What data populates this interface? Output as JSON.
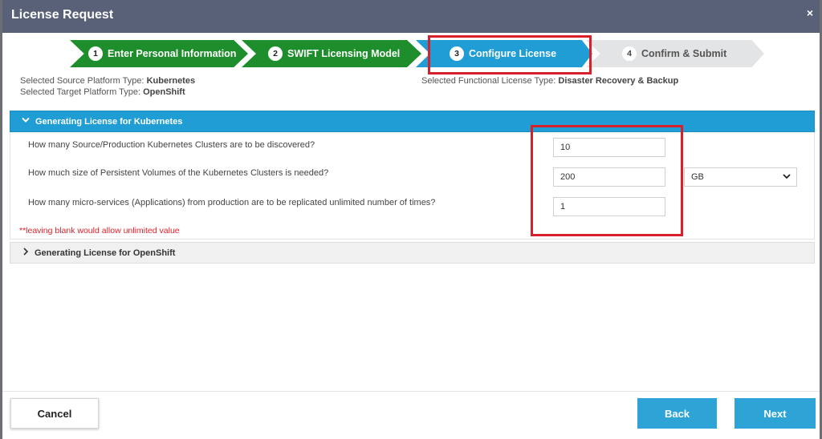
{
  "dialog": {
    "title": "License Request",
    "close_glyph": "×"
  },
  "stepper": {
    "steps": [
      {
        "num": "1",
        "label": "Enter Personal Information",
        "state": "done"
      },
      {
        "num": "2",
        "label": "SWIFT Licensing Model",
        "state": "done"
      },
      {
        "num": "3",
        "label": "Configure License",
        "state": "active"
      },
      {
        "num": "4",
        "label": "Confirm & Submit",
        "state": "pending"
      }
    ]
  },
  "info": {
    "source_label": "Selected Source Platform Type:",
    "source_value": "Kubernetes",
    "target_label": "Selected Target Platform Type:",
    "target_value": "OpenShift",
    "functional_label": "Selected Functional License Type:",
    "functional_value": "Disaster Recovery & Backup"
  },
  "panels": {
    "kubernetes": {
      "title": "Generating License for Kubernetes",
      "questions": [
        {
          "label": "How many Source/Production Kubernetes Clusters are to be discovered?",
          "value": "10"
        },
        {
          "label": "How much size of Persistent Volumes of the Kubernetes Clusters is needed?",
          "value": "200"
        },
        {
          "label": "How many micro-services (Applications) from production are to be replicated unlimited number of times?",
          "value": "1"
        }
      ],
      "unit_select": "GB",
      "note": "**leaving blank would allow unlimited value"
    },
    "openshift": {
      "title": "Generating License for OpenShift"
    }
  },
  "footer": {
    "cancel": "Cancel",
    "back": "Back",
    "next": "Next"
  },
  "colors": {
    "title_bar": "#596178",
    "step_done": "#1e8e2c",
    "step_active": "#1f9dd4",
    "highlight": "#d8202a",
    "button": "#2ea4d6"
  }
}
